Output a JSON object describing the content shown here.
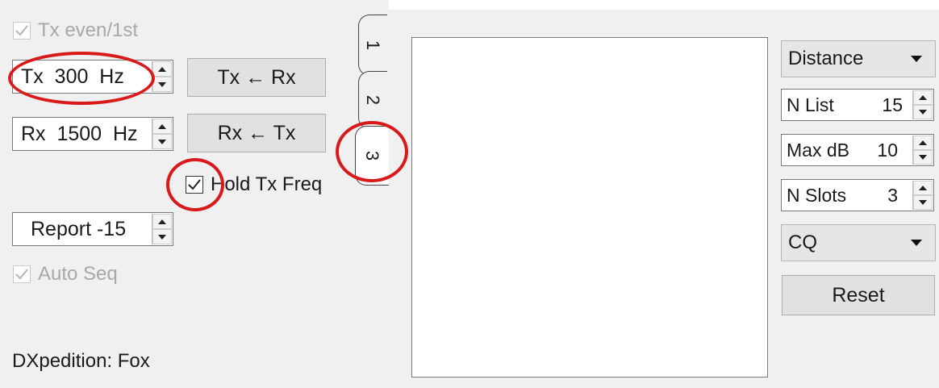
{
  "left_panel": {
    "tx_even": {
      "label": "Tx even/1st",
      "checked": true,
      "enabled": false
    },
    "tx_freq": {
      "value": "Tx  300  Hz"
    },
    "rx_freq": {
      "value": "Rx  1500  Hz"
    },
    "tx_from_rx_button": "Tx ← Rx",
    "rx_from_tx_button": "Rx ← Tx",
    "hold_tx_freq": {
      "label": "Hold Tx Freq",
      "checked": true
    },
    "report": {
      "value": "Report -15"
    },
    "auto_seq": {
      "label": "Auto Seq",
      "checked": true,
      "enabled": false
    },
    "status": "DXpedition: Fox"
  },
  "tabs": [
    {
      "label": "1"
    },
    {
      "label": "2"
    },
    {
      "label": "3",
      "selected": true
    }
  ],
  "right_panel": {
    "sort_combo": {
      "value": "Distance"
    },
    "n_list": {
      "label": "N List",
      "value": "15"
    },
    "max_db": {
      "label": "Max dB",
      "value": "10"
    },
    "n_slots": {
      "label": "N Slots",
      "value": "3"
    },
    "mode_combo": {
      "value": "CQ"
    },
    "reset_button": "Reset"
  },
  "annotations": {
    "highlight_color": "#d81a1a"
  }
}
